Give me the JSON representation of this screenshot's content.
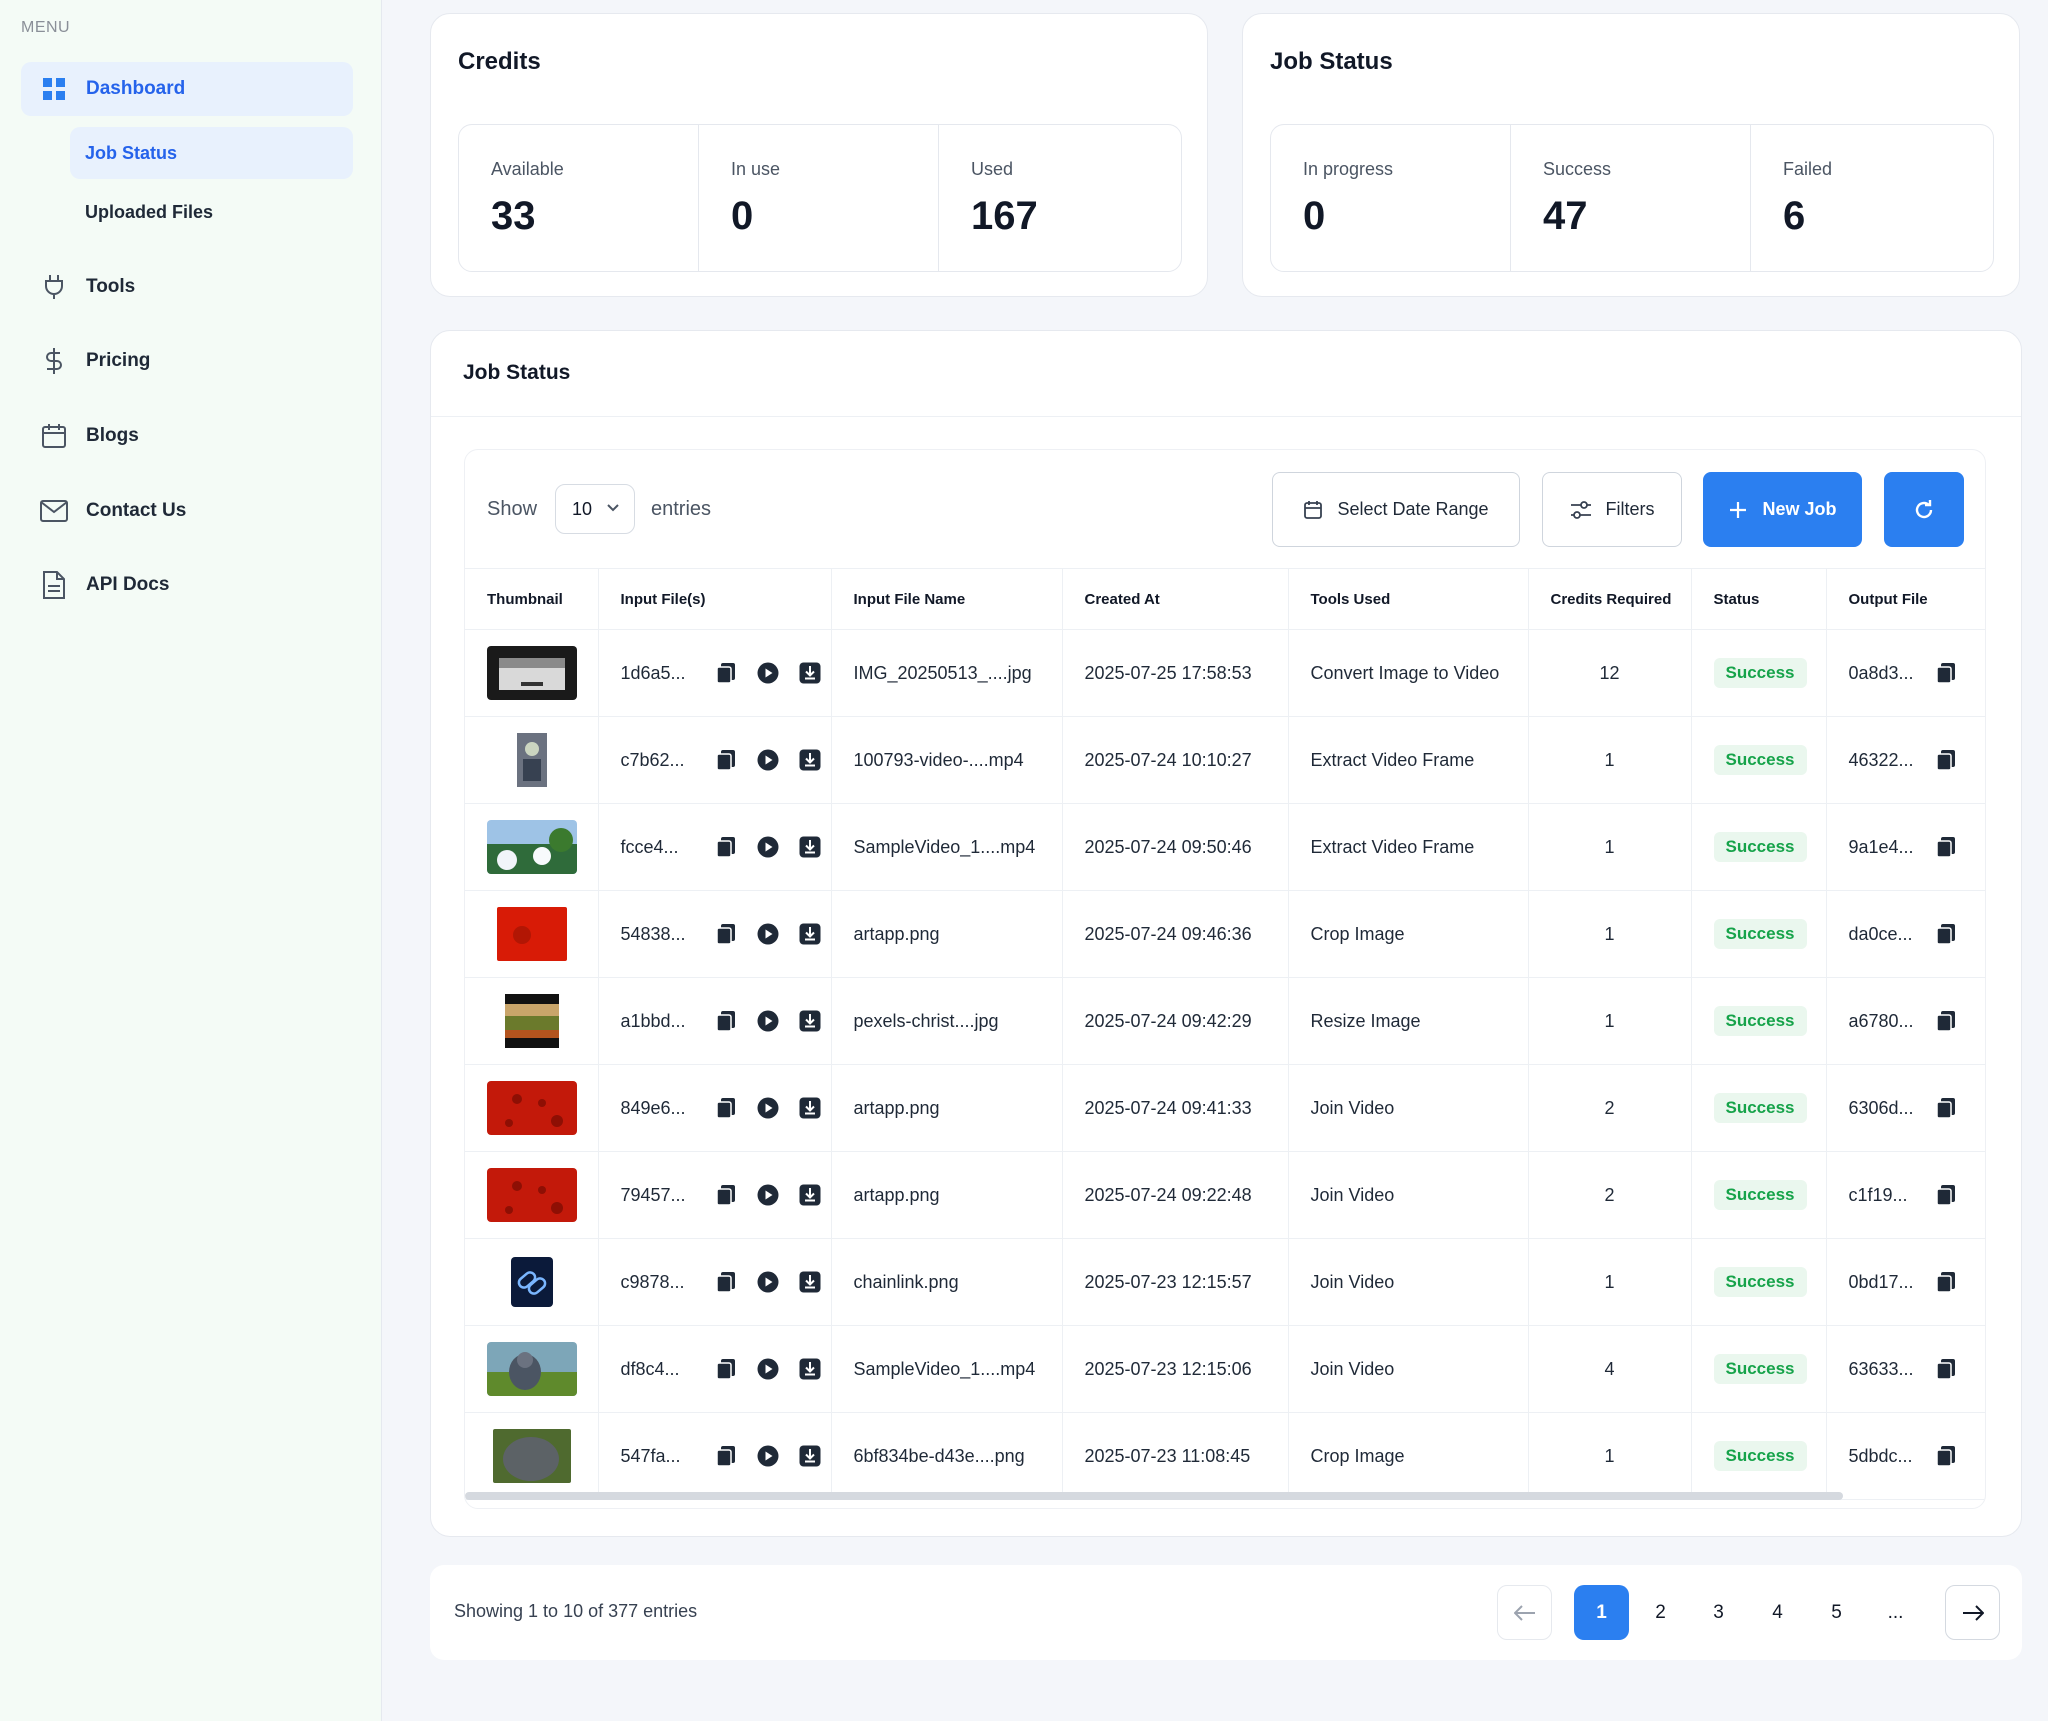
{
  "sidebar": {
    "menu_label": "MENU",
    "items": [
      {
        "label": "Dashboard",
        "icon": "grid-icon"
      },
      {
        "label": "Tools",
        "icon": "plug-icon"
      },
      {
        "label": "Pricing",
        "icon": "dollar-icon"
      },
      {
        "label": "Blogs",
        "icon": "calendar-icon"
      },
      {
        "label": "Contact Us",
        "icon": "mail-icon"
      },
      {
        "label": "API Docs",
        "icon": "document-icon"
      }
    ],
    "sub_items": [
      {
        "label": "Job Status"
      },
      {
        "label": "Uploaded Files"
      }
    ]
  },
  "credits": {
    "title": "Credits",
    "stats": [
      {
        "label": "Available",
        "value": "33"
      },
      {
        "label": "In use",
        "value": "0"
      },
      {
        "label": "Used",
        "value": "167"
      }
    ]
  },
  "job_status_summary": {
    "title": "Job Status",
    "stats": [
      {
        "label": "In progress",
        "value": "0"
      },
      {
        "label": "Success",
        "value": "47"
      },
      {
        "label": "Failed",
        "value": "6"
      }
    ]
  },
  "jobs": {
    "title": "Job Status",
    "show_label": "Show",
    "entries_select": "10",
    "entries_label": "entries",
    "date_range_label": "Select Date Range",
    "filters_label": "Filters",
    "new_job_label": "New Job",
    "columns": [
      "Thumbnail",
      "Input File(s)",
      "Input File Name",
      "Created At",
      "Tools Used",
      "Credits Required",
      "Status",
      "Output File"
    ],
    "rows": [
      {
        "input_id": "1d6a5...",
        "file_name": "IMG_20250513_....jpg",
        "created": "2025-07-25 17:58:53",
        "tool": "Convert Image to Video",
        "credits": "12",
        "status": "Success",
        "output": "0a8d3...",
        "thumb": "card"
      },
      {
        "input_id": "c7b62...",
        "file_name": "100793-video-....mp4",
        "created": "2025-07-24 10:10:27",
        "tool": "Extract Video Frame",
        "credits": "1",
        "status": "Success",
        "output": "46322...",
        "thumb": "portrait"
      },
      {
        "input_id": "fcce4...",
        "file_name": "SampleVideo_1....mp4",
        "created": "2025-07-24 09:50:46",
        "tool": "Extract Video Frame",
        "credits": "1",
        "status": "Success",
        "output": "9a1e4...",
        "thumb": "nature"
      },
      {
        "input_id": "54838...",
        "file_name": "artapp.png",
        "created": "2025-07-24 09:46:36",
        "tool": "Crop Image",
        "credits": "1",
        "status": "Success",
        "output": "da0ce...",
        "thumb": "red-square"
      },
      {
        "input_id": "a1bbd...",
        "file_name": "pexels-christ....jpg",
        "created": "2025-07-24 09:42:29",
        "tool": "Resize Image",
        "credits": "1",
        "status": "Success",
        "output": "a6780...",
        "thumb": "landscape"
      },
      {
        "input_id": "849e6...",
        "file_name": "artapp.png",
        "created": "2025-07-24 09:41:33",
        "tool": "Join Video",
        "credits": "2",
        "status": "Success",
        "output": "6306d...",
        "thumb": "red-wide"
      },
      {
        "input_id": "79457...",
        "file_name": "artapp.png",
        "created": "2025-07-24 09:22:48",
        "tool": "Join Video",
        "credits": "2",
        "status": "Success",
        "output": "c1f19...",
        "thumb": "red-wide"
      },
      {
        "input_id": "c9878...",
        "file_name": "chainlink.png",
        "created": "2025-07-23 12:15:57",
        "tool": "Join Video",
        "credits": "1",
        "status": "Success",
        "output": "0bd17...",
        "thumb": "chain"
      },
      {
        "input_id": "df8c4...",
        "file_name": "SampleVideo_1....mp4",
        "created": "2025-07-23 12:15:06",
        "tool": "Join Video",
        "credits": "4",
        "status": "Success",
        "output": "63633...",
        "thumb": "animal"
      },
      {
        "input_id": "547fa...",
        "file_name": "6bf834be-d43e....png",
        "created": "2025-07-23 11:08:45",
        "tool": "Crop Image",
        "credits": "1",
        "status": "Success",
        "output": "5dbdc...",
        "thumb": "rock"
      }
    ]
  },
  "pagination": {
    "info": "Showing 1 to 10 of 377 entries",
    "pages": [
      "1",
      "2",
      "3",
      "4",
      "5",
      "..."
    ],
    "current": "1"
  },
  "colors": {
    "accent": "#2b7ff0",
    "success": "#16a34a",
    "success_bg": "#eaf7ee"
  }
}
